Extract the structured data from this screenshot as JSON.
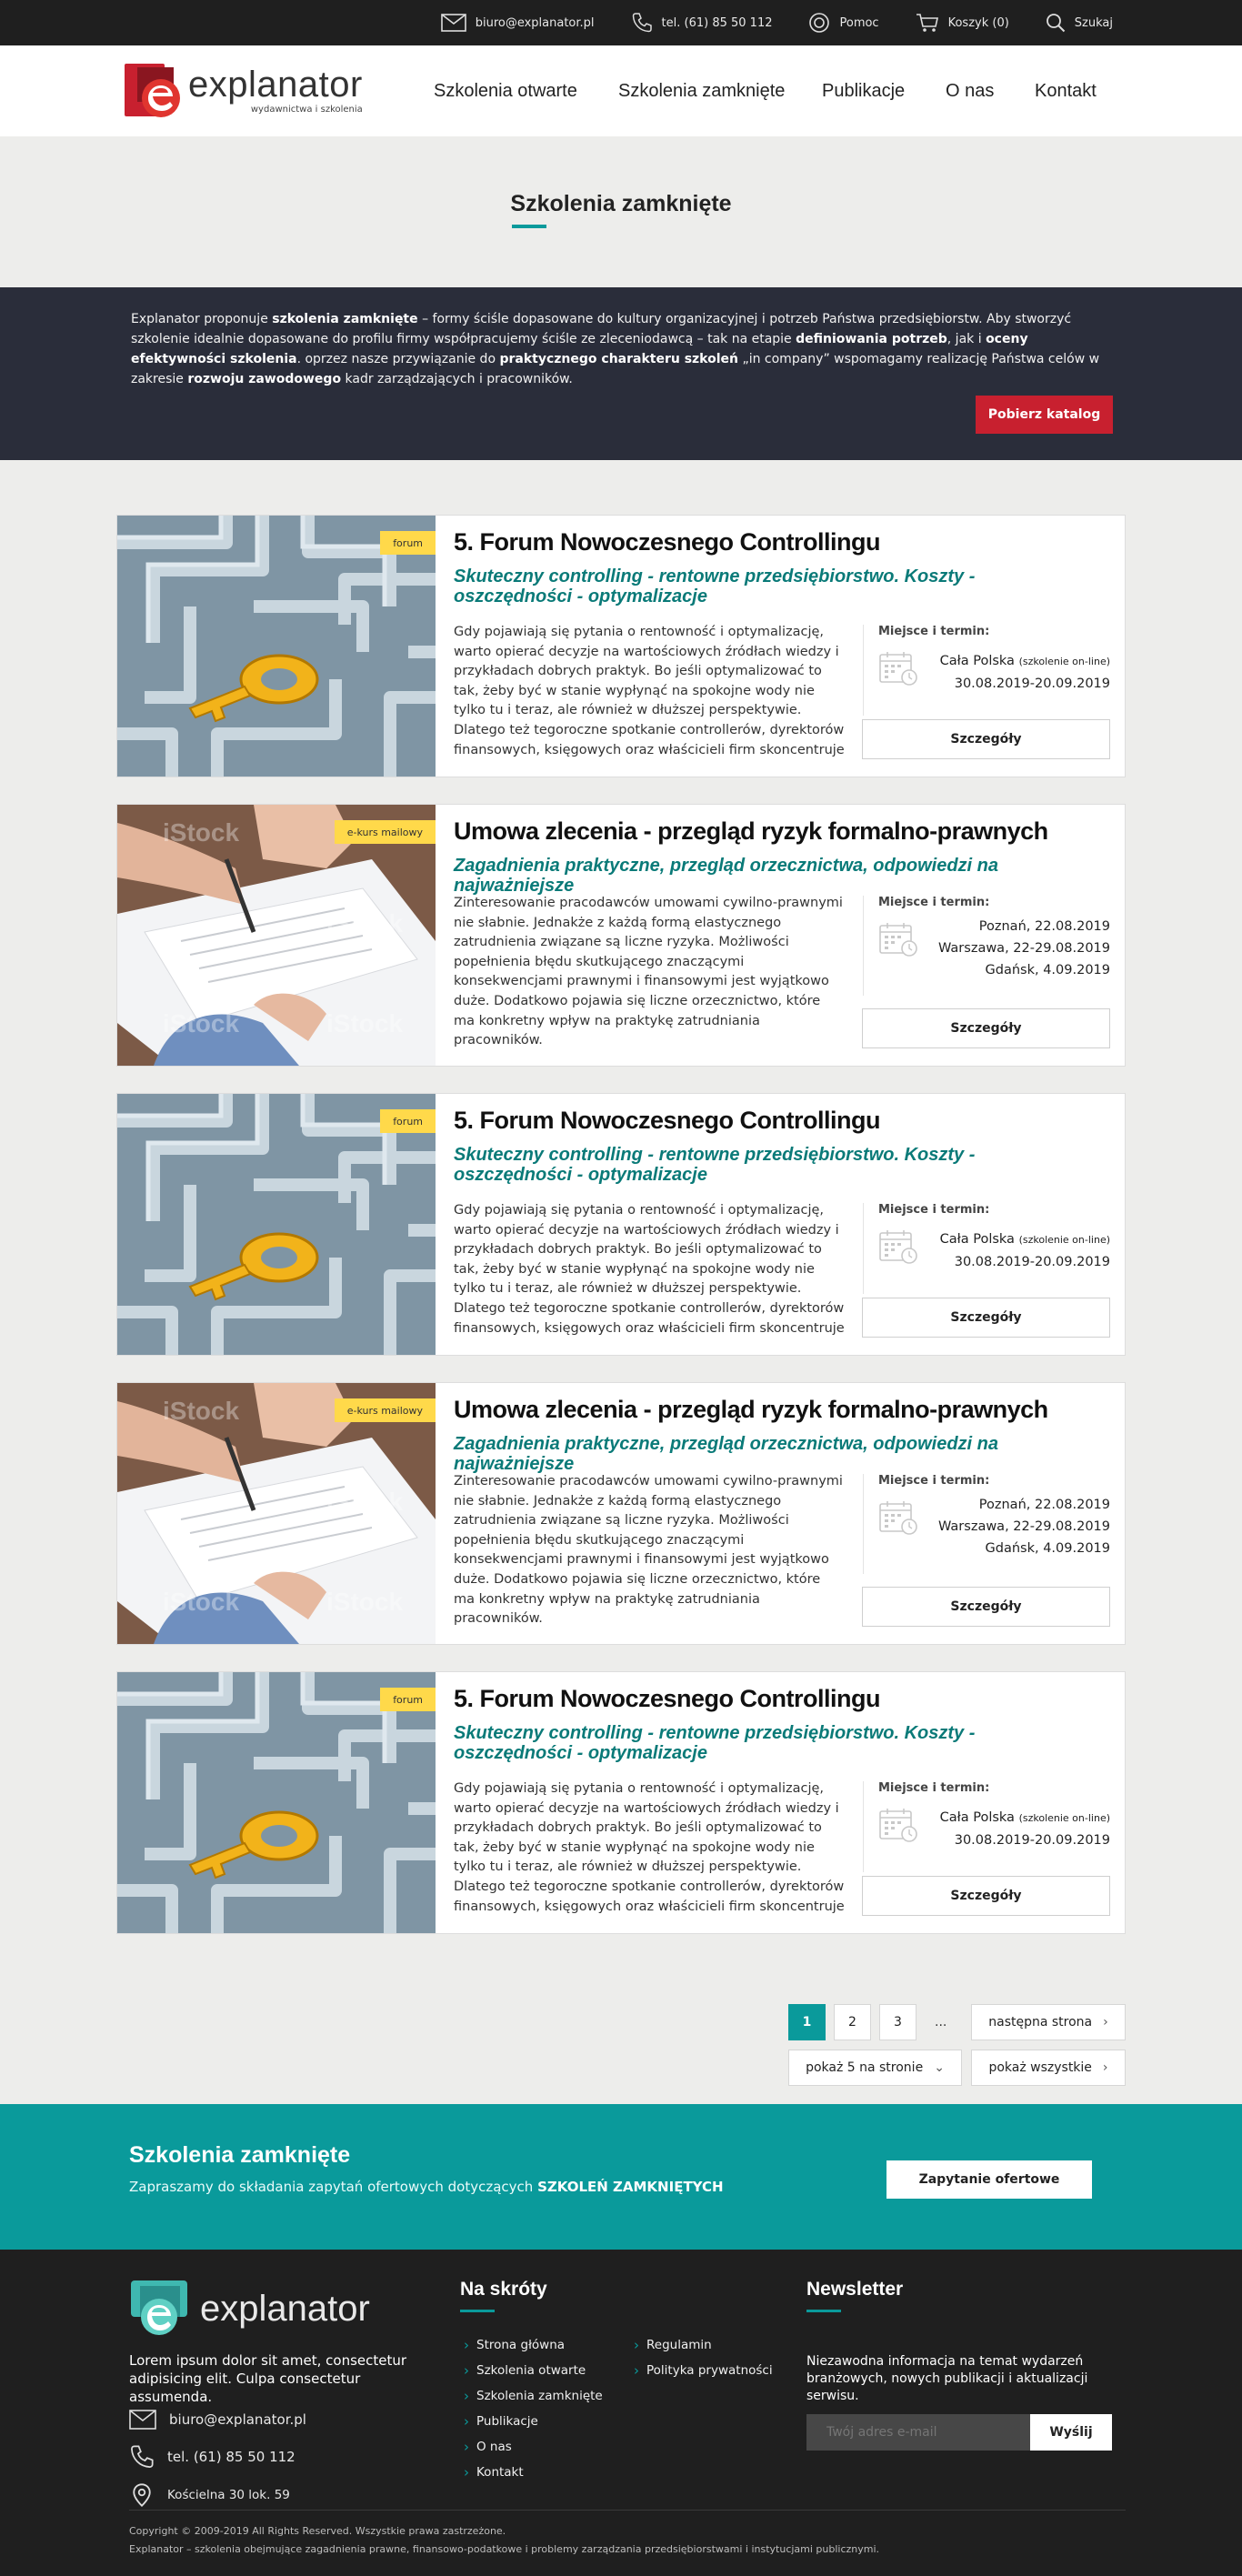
{
  "topbar": {
    "email": "biuro@explanator.pl",
    "phone": "tel. (61) 85 50 112",
    "help": "Pomoc",
    "cart": "Koszyk (0)",
    "search": "Szukaj"
  },
  "header": {
    "logo_name": "explanator",
    "logo_sub": "wydawnictwa i szkolenia",
    "nav": [
      "Szkolenia otwarte",
      "Szkolenia zamknięte",
      "Publikacje",
      "O nas",
      "Kontakt"
    ]
  },
  "page": {
    "title": "Szkolenia zamknięte"
  },
  "intro": {
    "p1": "Explanator proponuje ",
    "b1": "szkolenia zamknięte",
    "p2": " – formy ściśle dopasowane do kultury organizacyjnej i potrzeb Państwa przedsiębiorstw. Aby stworzyć szkolenie idealnie dopasowane do profilu firmy współpracujemy ściśle ze zleceniodawcą – tak na etapie ",
    "b2": "definiowania potrzeb",
    "p3": ", jak i ",
    "b3": "oceny efektywności szkolenia",
    "p4": ". oprzez nasze przywiązanie do ",
    "b4": "praktycznego charakteru szkoleń",
    "p5": " „in company” wspomagamy realizację Państwa celów w zakresie ",
    "b5": "rozwoju zawodowego",
    "p6": " kadr zarządzających i pracowników.",
    "button": "Pobierz katalog"
  },
  "labels": {
    "place_time": "Miejsce i termin:",
    "details": "Szczegóły"
  },
  "trainings": [
    {
      "tag": "forum",
      "title": "5. Forum Nowoczesnego Controllingu",
      "subtitle": "Skuteczny controlling - rentowne przedsiębiorstwo. Koszty - oszczędności - optymalizacje",
      "description": "Gdy pojawiają się pytania o rentowność i optymalizację, warto opierać decyzje na wartościowych źródłach wiedzy i przykładach dobrych praktyk. Bo jeśli optymalizować to tak, żeby być w stanie wypłynąć na spokojne wody nie tylko tu i teraz, ale również w dłuższej perspektywie. Dlatego też tegoroczne spotkanie controllerów, dyrektorów finansowych, księgowych oraz właścicieli firm skoncentruje",
      "place": "Cała Polska",
      "place_note": "(szkolenie on-line)",
      "dates": "30.08.2019-20.09.2019"
    },
    {
      "tag": "e-kurs mailowy",
      "title": "Umowa zlecenia - przegląd ryzyk formalno-prawnych",
      "subtitle": "Zagadnienia praktyczne, przegląd orzecznictwa, odpowiedzi na najważniejsze",
      "description": "Zinteresowanie pracodawców umowami cywilno-prawnymi nie słabnie. Jednakże z każdą formą elastycznego zatrudnienia związane są liczne ryzyka. Możliwości popełnienia błędu skutkującego znaczącymi konsekwencjami prawnymi i finansowymi jest wyjątkowo duże. Dodatkowo pojawia się liczne orzecznictwo, które ma konkretny wpływ na praktykę zatrudniania pracowników.",
      "lines": [
        "Poznań, 22.08.2019",
        "Warszawa, 22-29.08.2019",
        "Gdańsk, 4.09.2019"
      ]
    },
    {
      "tag": "forum",
      "title": "5. Forum Nowoczesnego Controllingu",
      "subtitle": "Skuteczny controlling - rentowne przedsiębiorstwo. Koszty - oszczędności - optymalizacje",
      "description": "Gdy pojawiają się pytania o rentowność i optymalizację, warto opierać decyzje na wartościowych źródłach wiedzy i przykładach dobrych praktyk. Bo jeśli optymalizować to tak, żeby być w stanie wypłynąć na spokojne wody nie tylko tu i teraz, ale również w dłuższej perspektywie. Dlatego też tegoroczne spotkanie controllerów, dyrektorów finansowych, księgowych oraz właścicieli firm skoncentruje",
      "place": "Cała Polska",
      "place_note": "(szkolenie on-line)",
      "dates": "30.08.2019-20.09.2019"
    },
    {
      "tag": "e-kurs mailowy",
      "title": "Umowa zlecenia - przegląd ryzyk formalno-prawnych",
      "subtitle": "Zagadnienia praktyczne, przegląd orzecznictwa, odpowiedzi na najważniejsze",
      "description": "Zinteresowanie pracodawców umowami cywilno-prawnymi nie słabnie. Jednakże z każdą formą elastycznego zatrudnienia związane są liczne ryzyka. Możliwości popełnienia błędu skutkującego znaczącymi konsekwencjami prawnymi i finansowymi jest wyjątkowo duże. Dodatkowo pojawia się liczne orzecznictwo, które ma konkretny wpływ na praktykę zatrudniania pracowników.",
      "lines": [
        "Poznań, 22.08.2019",
        "Warszawa, 22-29.08.2019",
        "Gdańsk, 4.09.2019"
      ]
    },
    {
      "tag": "forum",
      "title": "5. Forum Nowoczesnego Controllingu",
      "subtitle": "Skuteczny controlling - rentowne przedsiębiorstwo. Koszty - oszczędności - optymalizacje",
      "description": "Gdy pojawiają się pytania o rentowność i optymalizację, warto opierać decyzje na wartościowych źródłach wiedzy i przykładach dobrych praktyk. Bo jeśli optymalizować to tak, żeby być w stanie wypłynąć na spokojne wody nie tylko tu i teraz, ale również w dłuższej perspektywie. Dlatego też tegoroczne spotkanie controllerów, dyrektorów finansowych, księgowych oraz właścicieli firm skoncentruje",
      "place": "Cała Polska",
      "place_note": "(szkolenie on-line)",
      "dates": "30.08.2019-20.09.2019"
    }
  ],
  "pagination": {
    "pages": [
      "1",
      "2",
      "3"
    ],
    "active": "1",
    "ellipsis": "...",
    "next": "następna strona",
    "per_page": "pokaż 5 na stronie",
    "show_all": "pokaż wszystkie"
  },
  "cta": {
    "title": "Szkolenia zamknięte",
    "text": "Zapraszamy do składania zapytań ofertowych dotyczących ",
    "text_bold": "SZKOLEŃ ZAMKNIĘTYCH",
    "button": "Zapytanie ofertowe"
  },
  "footer": {
    "logo_name": "explanator",
    "about": "Lorem ipsum dolor sit amet, consectetur adipisicing elit. Culpa consectetur assumenda.",
    "email": "biuro@explanator.pl",
    "phone": "tel. (61) 85 50 112",
    "address": "Kościelna 30 lok. 59",
    "shortcuts_title": "Na skróty",
    "shortcuts_col1": [
      "Strona główna",
      "Szkolenia otwarte",
      "Szkolenia zamknięte",
      "Publikacje",
      "O nas",
      "Kontakt"
    ],
    "shortcuts_col2": [
      "Regulamin",
      "Polityka prywatności"
    ],
    "newsletter_title": "Newsletter",
    "newsletter_text": "Niezawodna informacja na temat wydarzeń branżowych, nowych publikacji i aktualizacji serwisu.",
    "newsletter_placeholder": "Twój adres e-mail",
    "newsletter_button": "Wyślij",
    "copyright": "Copyright © 2009-2019 All Rights Reserved. Wszystkie prawa zastrzeżone.",
    "tagline": "Explanator – szkolenia obejmujące zagadnienia prawne, finansowo-podatkowe i problemy zarządzania przedsiębiorstwami i instytucjami publicznymi."
  },
  "colors": {
    "teal": "#0a9a9b",
    "dark_band": "#2a2d3a",
    "red_button": "#c8202f",
    "tag_yellow": "#ffd94a",
    "subtitle_teal": "#0a7a78"
  }
}
